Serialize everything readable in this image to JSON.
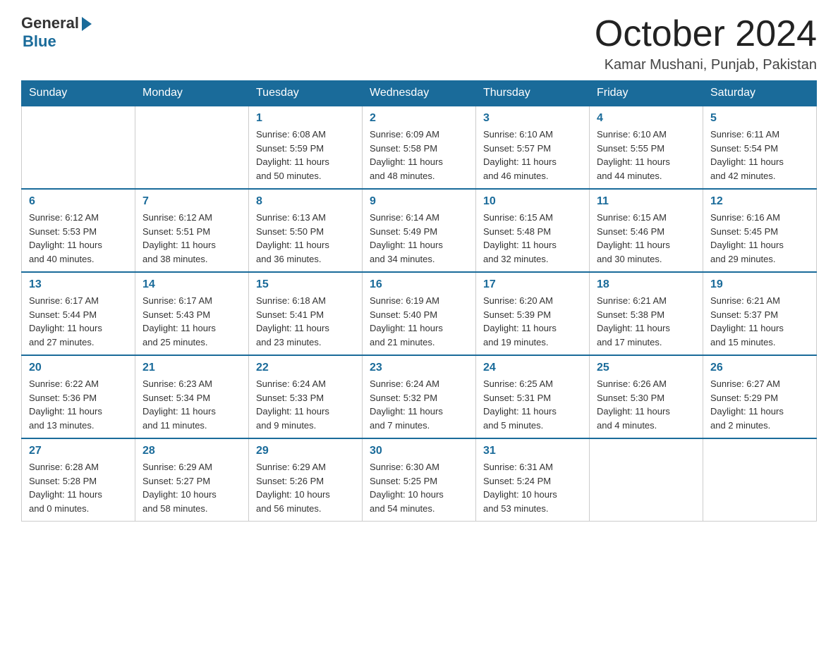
{
  "logo": {
    "general": "General",
    "blue": "Blue"
  },
  "title": "October 2024",
  "location": "Kamar Mushani, Punjab, Pakistan",
  "weekdays": [
    "Sunday",
    "Monday",
    "Tuesday",
    "Wednesday",
    "Thursday",
    "Friday",
    "Saturday"
  ],
  "weeks": [
    [
      {
        "day": "",
        "info": ""
      },
      {
        "day": "",
        "info": ""
      },
      {
        "day": "1",
        "info": "Sunrise: 6:08 AM\nSunset: 5:59 PM\nDaylight: 11 hours\nand 50 minutes."
      },
      {
        "day": "2",
        "info": "Sunrise: 6:09 AM\nSunset: 5:58 PM\nDaylight: 11 hours\nand 48 minutes."
      },
      {
        "day": "3",
        "info": "Sunrise: 6:10 AM\nSunset: 5:57 PM\nDaylight: 11 hours\nand 46 minutes."
      },
      {
        "day": "4",
        "info": "Sunrise: 6:10 AM\nSunset: 5:55 PM\nDaylight: 11 hours\nand 44 minutes."
      },
      {
        "day": "5",
        "info": "Sunrise: 6:11 AM\nSunset: 5:54 PM\nDaylight: 11 hours\nand 42 minutes."
      }
    ],
    [
      {
        "day": "6",
        "info": "Sunrise: 6:12 AM\nSunset: 5:53 PM\nDaylight: 11 hours\nand 40 minutes."
      },
      {
        "day": "7",
        "info": "Sunrise: 6:12 AM\nSunset: 5:51 PM\nDaylight: 11 hours\nand 38 minutes."
      },
      {
        "day": "8",
        "info": "Sunrise: 6:13 AM\nSunset: 5:50 PM\nDaylight: 11 hours\nand 36 minutes."
      },
      {
        "day": "9",
        "info": "Sunrise: 6:14 AM\nSunset: 5:49 PM\nDaylight: 11 hours\nand 34 minutes."
      },
      {
        "day": "10",
        "info": "Sunrise: 6:15 AM\nSunset: 5:48 PM\nDaylight: 11 hours\nand 32 minutes."
      },
      {
        "day": "11",
        "info": "Sunrise: 6:15 AM\nSunset: 5:46 PM\nDaylight: 11 hours\nand 30 minutes."
      },
      {
        "day": "12",
        "info": "Sunrise: 6:16 AM\nSunset: 5:45 PM\nDaylight: 11 hours\nand 29 minutes."
      }
    ],
    [
      {
        "day": "13",
        "info": "Sunrise: 6:17 AM\nSunset: 5:44 PM\nDaylight: 11 hours\nand 27 minutes."
      },
      {
        "day": "14",
        "info": "Sunrise: 6:17 AM\nSunset: 5:43 PM\nDaylight: 11 hours\nand 25 minutes."
      },
      {
        "day": "15",
        "info": "Sunrise: 6:18 AM\nSunset: 5:41 PM\nDaylight: 11 hours\nand 23 minutes."
      },
      {
        "day": "16",
        "info": "Sunrise: 6:19 AM\nSunset: 5:40 PM\nDaylight: 11 hours\nand 21 minutes."
      },
      {
        "day": "17",
        "info": "Sunrise: 6:20 AM\nSunset: 5:39 PM\nDaylight: 11 hours\nand 19 minutes."
      },
      {
        "day": "18",
        "info": "Sunrise: 6:21 AM\nSunset: 5:38 PM\nDaylight: 11 hours\nand 17 minutes."
      },
      {
        "day": "19",
        "info": "Sunrise: 6:21 AM\nSunset: 5:37 PM\nDaylight: 11 hours\nand 15 minutes."
      }
    ],
    [
      {
        "day": "20",
        "info": "Sunrise: 6:22 AM\nSunset: 5:36 PM\nDaylight: 11 hours\nand 13 minutes."
      },
      {
        "day": "21",
        "info": "Sunrise: 6:23 AM\nSunset: 5:34 PM\nDaylight: 11 hours\nand 11 minutes."
      },
      {
        "day": "22",
        "info": "Sunrise: 6:24 AM\nSunset: 5:33 PM\nDaylight: 11 hours\nand 9 minutes."
      },
      {
        "day": "23",
        "info": "Sunrise: 6:24 AM\nSunset: 5:32 PM\nDaylight: 11 hours\nand 7 minutes."
      },
      {
        "day": "24",
        "info": "Sunrise: 6:25 AM\nSunset: 5:31 PM\nDaylight: 11 hours\nand 5 minutes."
      },
      {
        "day": "25",
        "info": "Sunrise: 6:26 AM\nSunset: 5:30 PM\nDaylight: 11 hours\nand 4 minutes."
      },
      {
        "day": "26",
        "info": "Sunrise: 6:27 AM\nSunset: 5:29 PM\nDaylight: 11 hours\nand 2 minutes."
      }
    ],
    [
      {
        "day": "27",
        "info": "Sunrise: 6:28 AM\nSunset: 5:28 PM\nDaylight: 11 hours\nand 0 minutes."
      },
      {
        "day": "28",
        "info": "Sunrise: 6:29 AM\nSunset: 5:27 PM\nDaylight: 10 hours\nand 58 minutes."
      },
      {
        "day": "29",
        "info": "Sunrise: 6:29 AM\nSunset: 5:26 PM\nDaylight: 10 hours\nand 56 minutes."
      },
      {
        "day": "30",
        "info": "Sunrise: 6:30 AM\nSunset: 5:25 PM\nDaylight: 10 hours\nand 54 minutes."
      },
      {
        "day": "31",
        "info": "Sunrise: 6:31 AM\nSunset: 5:24 PM\nDaylight: 10 hours\nand 53 minutes."
      },
      {
        "day": "",
        "info": ""
      },
      {
        "day": "",
        "info": ""
      }
    ]
  ]
}
